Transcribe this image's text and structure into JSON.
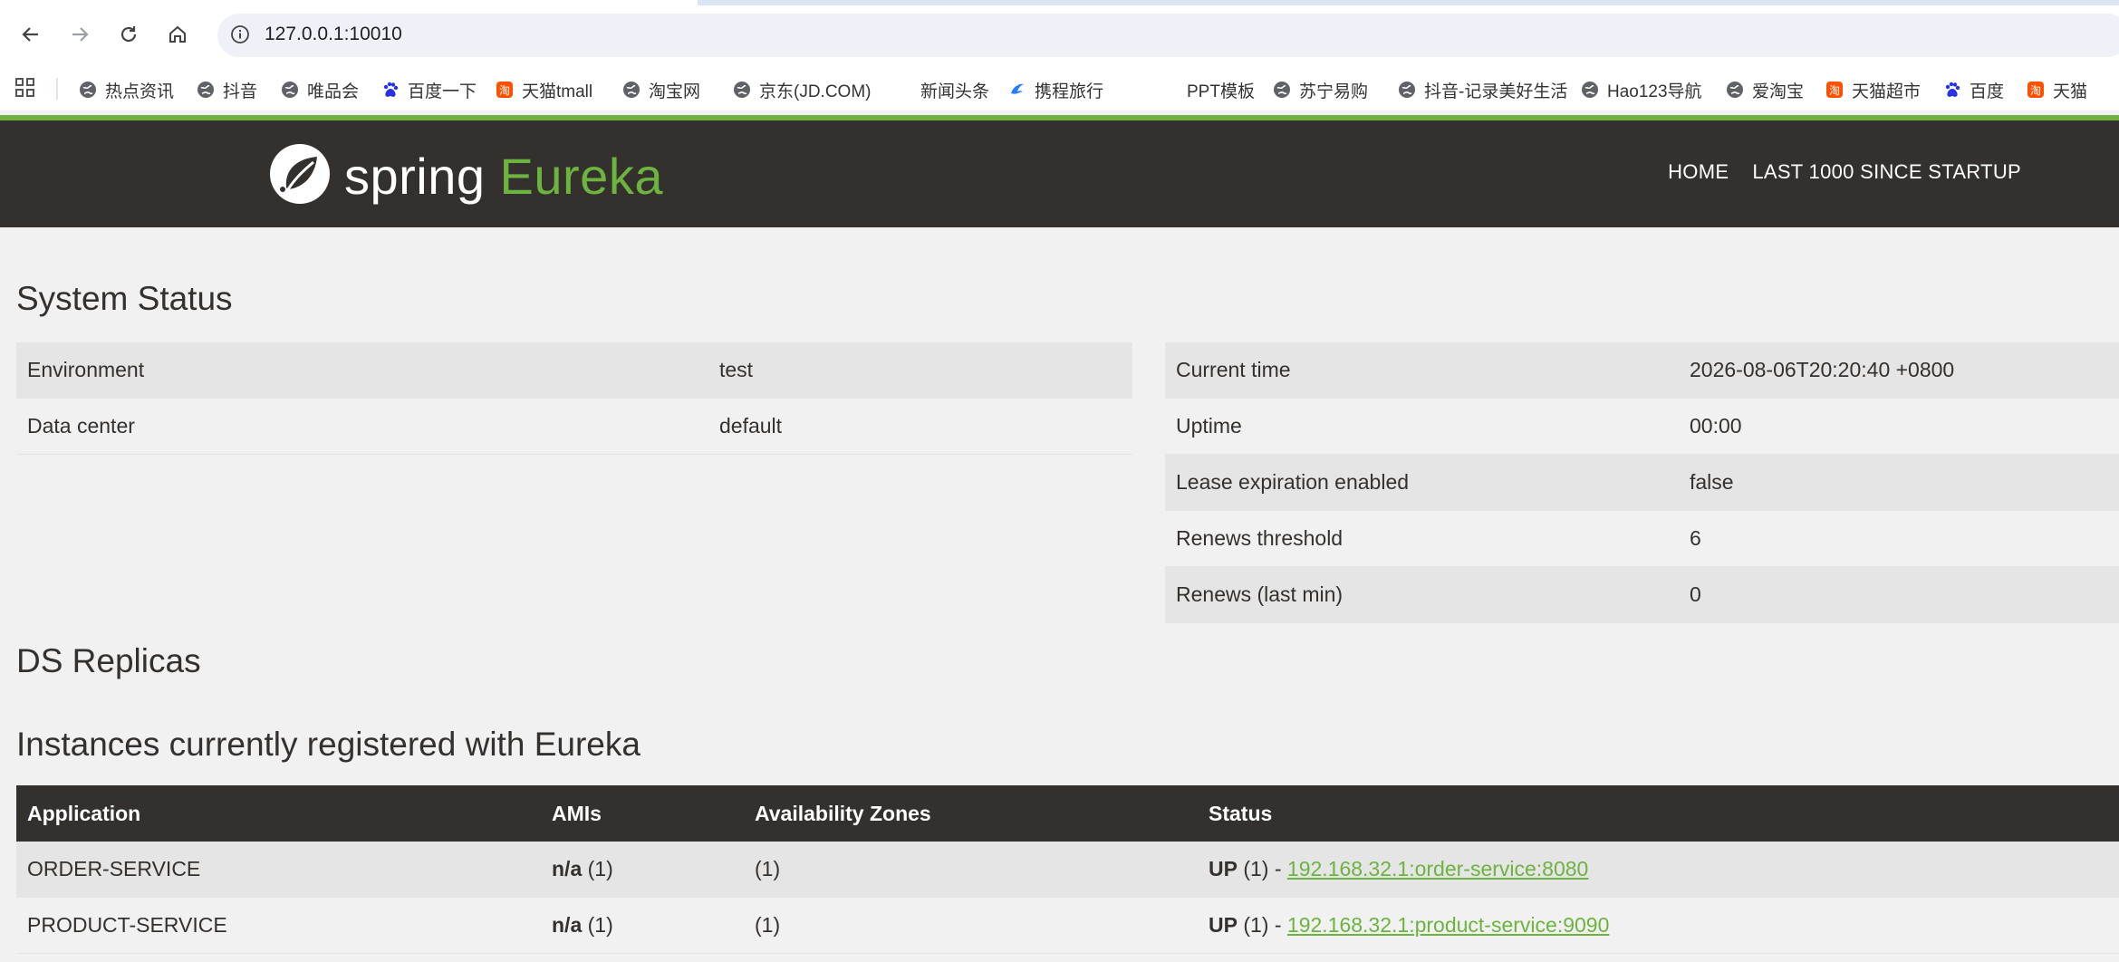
{
  "browser": {
    "url": "127.0.0.1:10010",
    "bookmarks": [
      {
        "label": "热点资讯",
        "icon": "globe-icon"
      },
      {
        "label": "抖音",
        "icon": "globe-icon"
      },
      {
        "label": "唯品会",
        "icon": "globe-icon"
      },
      {
        "label": "百度一下",
        "icon": "baidu-paw-icon"
      },
      {
        "label": "天猫tmall",
        "icon": "taobao-icon"
      },
      {
        "label": "淘宝网",
        "icon": "globe-icon"
      },
      {
        "label": "京东(JD.COM)",
        "icon": "globe-icon"
      },
      {
        "label": "新闻头条",
        "icon": ""
      },
      {
        "label": "携程旅行",
        "icon": "ctrip-icon"
      },
      {
        "label": "PPT模板",
        "icon": ""
      },
      {
        "label": "苏宁易购",
        "icon": "globe-icon"
      },
      {
        "label": "抖音-记录美好生活",
        "icon": "globe-icon"
      },
      {
        "label": "Hao123导航",
        "icon": "globe-icon"
      },
      {
        "label": "爱淘宝",
        "icon": "globe-icon"
      },
      {
        "label": "天猫超市",
        "icon": "taobao-icon"
      },
      {
        "label": "百度",
        "icon": "baidu-paw-icon"
      },
      {
        "label": "天猫",
        "icon": "taobao-icon"
      }
    ]
  },
  "navbar": {
    "logo_word1": "spring",
    "logo_word2": "Eureka",
    "links": [
      "HOME",
      "LAST 1000 SINCE STARTUP"
    ]
  },
  "system_status": {
    "title": "System Status",
    "left": [
      {
        "key": "Environment",
        "value": "test"
      },
      {
        "key": "Data center",
        "value": "default"
      }
    ],
    "right": [
      {
        "key": "Current time",
        "value": "2026-08-06T20:20:40 +0800"
      },
      {
        "key": "Uptime",
        "value": "00:00"
      },
      {
        "key": "Lease expiration enabled",
        "value": "false"
      },
      {
        "key": "Renews threshold",
        "value": "6"
      },
      {
        "key": "Renews (last min)",
        "value": "0"
      }
    ]
  },
  "ds_replicas": {
    "title": "DS Replicas"
  },
  "instances": {
    "title": "Instances currently registered with Eureka",
    "headers": [
      "Application",
      "AMIs",
      "Availability Zones",
      "Status"
    ],
    "rows": [
      {
        "app": "ORDER-SERVICE",
        "ami_bold": "n/a",
        "ami_count": " (1)",
        "zones": "(1)",
        "status_bold": "UP",
        "status_count": " (1) - ",
        "link": "192.168.32.1:order-service:8080"
      },
      {
        "app": "PRODUCT-SERVICE",
        "ami_bold": "n/a",
        "ami_count": " (1)",
        "zones": "(1)",
        "status_bold": "UP",
        "status_count": " (1) - ",
        "link": "192.168.32.1:product-service:9090"
      }
    ]
  },
  "colors": {
    "brand_green": "#6db33f",
    "navbar_dark": "#34302d",
    "page_bg": "#f1f1f1"
  }
}
